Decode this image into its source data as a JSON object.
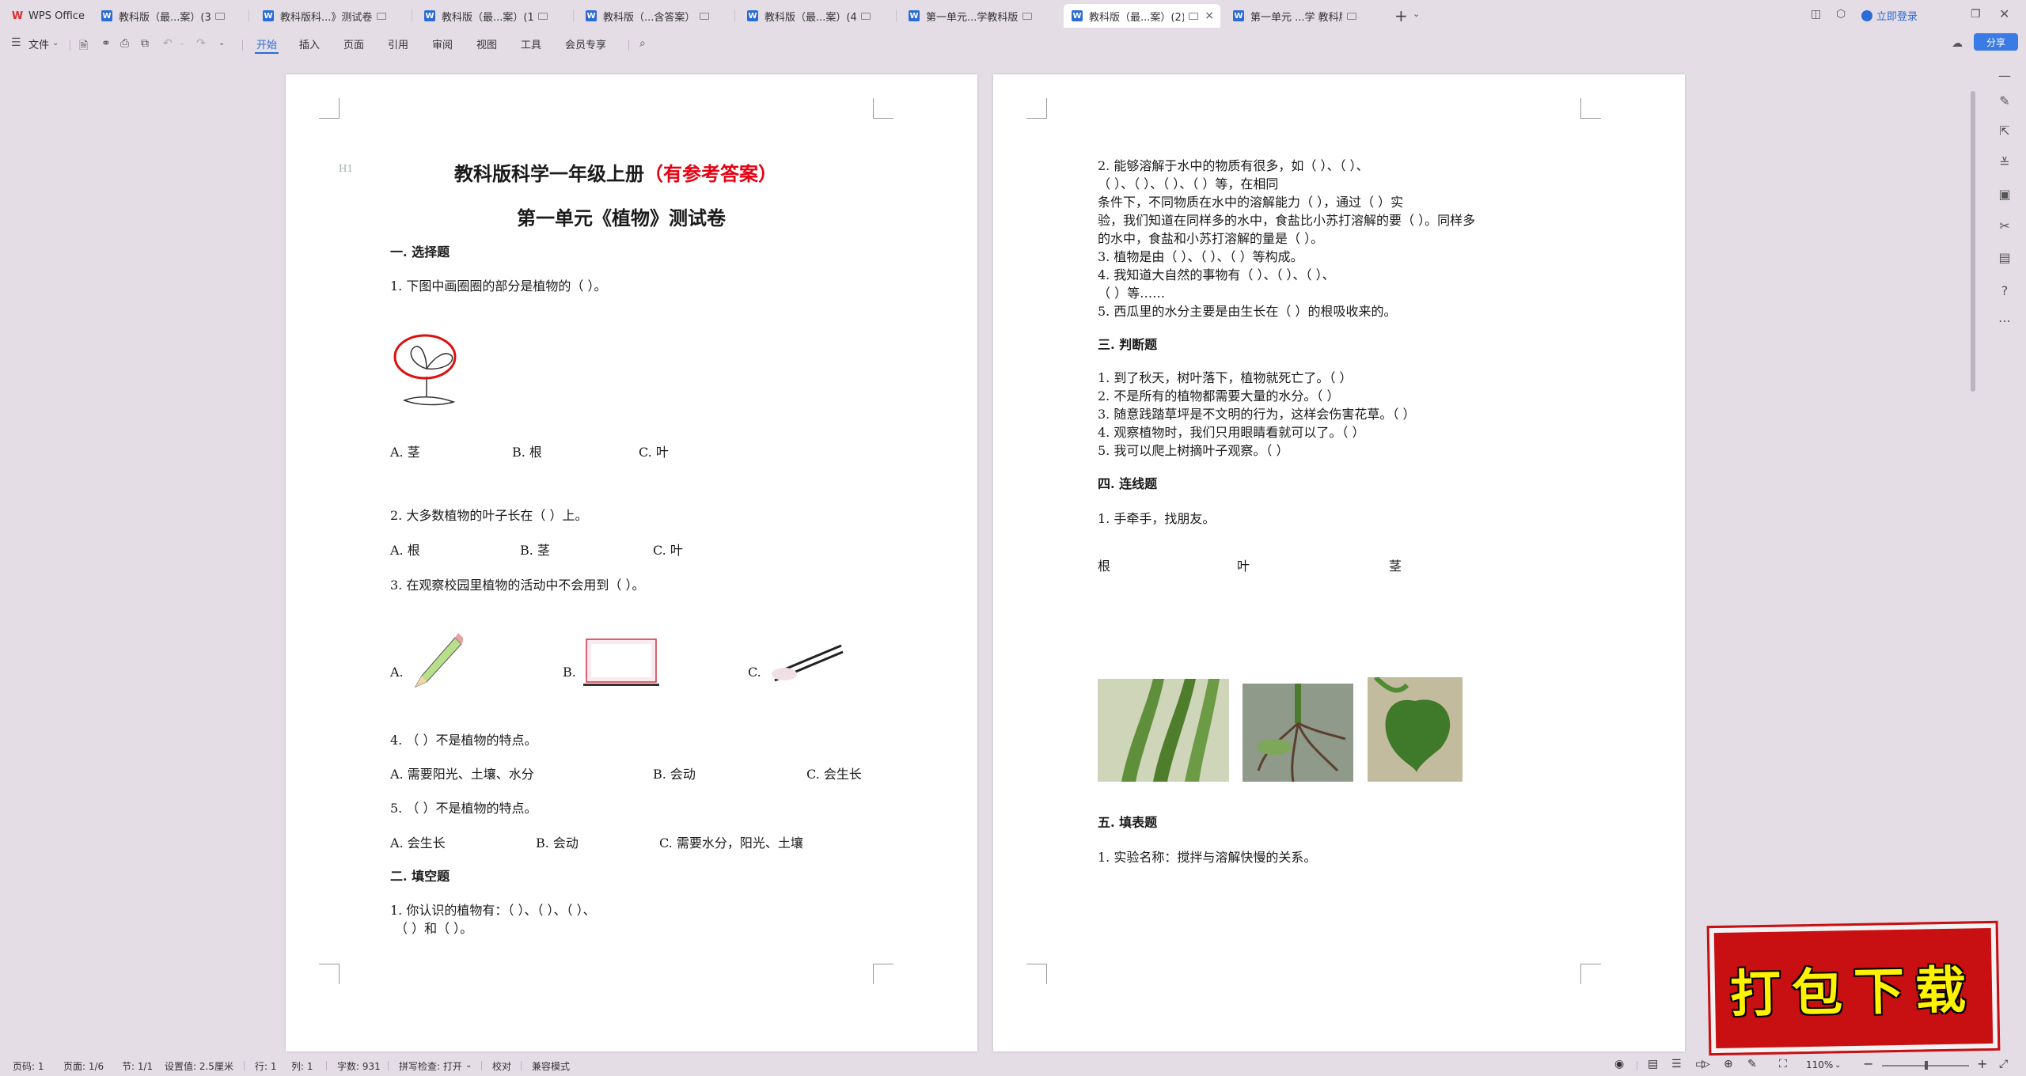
{
  "tabs": [
    {
      "label": "WPS Office",
      "kind": "home"
    },
    {
      "label": "教科版（最...案）(3)",
      "kind": "doc"
    },
    {
      "label": "教科版科...》测试卷",
      "kind": "doc"
    },
    {
      "label": "教科版（最...案）(1)",
      "kind": "doc"
    },
    {
      "label": "教科版（...含答案）",
      "kind": "doc"
    },
    {
      "label": "教科版（最...案）(4)",
      "kind": "doc"
    },
    {
      "label": "第一单元...学教科版",
      "kind": "doc"
    },
    {
      "label": "教科版（最...案）(2)",
      "kind": "doc",
      "active": true
    },
    {
      "label": "第一单元 ...学 教科版",
      "kind": "doc"
    }
  ],
  "titlebar": {
    "login": "立即登录"
  },
  "menu": {
    "file": "文件",
    "items": [
      "开始",
      "插入",
      "页面",
      "引用",
      "审阅",
      "视图",
      "工具",
      "会员专享"
    ],
    "share": "分享"
  },
  "page1": {
    "hmark": "H1",
    "title_main": "教科版科学一年级上册",
    "title_red": "（有参考答案）",
    "subtitle": "第一单元《植物》测试卷",
    "sec1": "一. 选择题",
    "q1": "1. 下图中画圈圈的部分是植物的（        ）。",
    "q1_opts": [
      "A. 茎",
      "B. 根",
      "C. 叶"
    ],
    "q2": "2. 大多数植物的叶子长在（        ）上。",
    "q2_opts": [
      "A. 根",
      "B. 茎",
      "C. 叶"
    ],
    "q3": "3. 在观察校园里植物的活动中不会用到（        ）。",
    "q3_opts": [
      "A.",
      "B.",
      "C."
    ],
    "q4": "4. （        ）不是植物的特点。",
    "q4_opts": [
      "A. 需要阳光、土壤、水分",
      "B. 会动",
      "C. 会生长"
    ],
    "q5": "5. （        ）不是植物的特点。",
    "q5_opts": [
      "A. 会生长",
      "B. 会动",
      "C. 需要水分，阳光、土壤"
    ],
    "sec2": "二. 填空题",
    "f1a": "1. 你认识的植物有：（              ）、（              ）、（              ）、",
    "f1b": "（              ）和（              ）。"
  },
  "page2": {
    "f2a": "2. 能够溶解于水中的物质有很多，如（              ）、（              ）、",
    "f2b": "（              ）、（              ）、（              ）、（              ）等，在相同",
    "f2c": "条件下，不同物质在水中的溶解能力（              ），通过（              ）实",
    "f2d": "验，我们知道在同样多的水中，食盐比小苏打溶解的要（              ）。同样多",
    "f2e": "的水中，食盐和小苏打溶解的量是（              ）。",
    "f3": "3. 植物是由（              ）、（              ）、（              ）等构成。",
    "f4a": "4. 我知道大自然的事物有（              ）、（              ）、（              ）、",
    "f4b": "（              ）等……",
    "f5": "5. 西瓜里的水分主要是由生长在（              ）的根吸收来的。",
    "sec3": "三. 判断题",
    "j": [
      "1. 到了秋天，树叶落下，植物就死亡了。（        ）",
      "2. 不是所有的植物都需要大量的水分。（        ）",
      "3. 随意践踏草坪是不文明的行为，这样会伤害花草。（        ）",
      "4. 观察植物时，我们只用眼睛看就可以了。（        ）",
      "5. 我可以爬上树摘叶子观察。（        ）"
    ],
    "sec4": "四. 连线题",
    "m1": "1. 手牵手，找朋友。",
    "match": [
      "根",
      "叶",
      "茎"
    ],
    "sec5": "五. 填表题",
    "t1": "1. 实验名称：搅拌与溶解快慢的关系。"
  },
  "status": {
    "page": "页码: 1",
    "pages": "页面: 1/6",
    "section": "节: 1/1",
    "setting": "设置值: 2.5厘米",
    "row": "行: 1",
    "col": "列: 1",
    "words": "字数: 931",
    "spell": "拼写检查: 打开",
    "proof": "校对",
    "compat": "兼容模式",
    "zoom": "110%"
  },
  "stamp": "打包下载",
  "colors": {
    "accent": "#2b6bd6",
    "red_text": "#e60012",
    "stamp_bg": "#c80f12",
    "stamp_text": "#fff200"
  }
}
